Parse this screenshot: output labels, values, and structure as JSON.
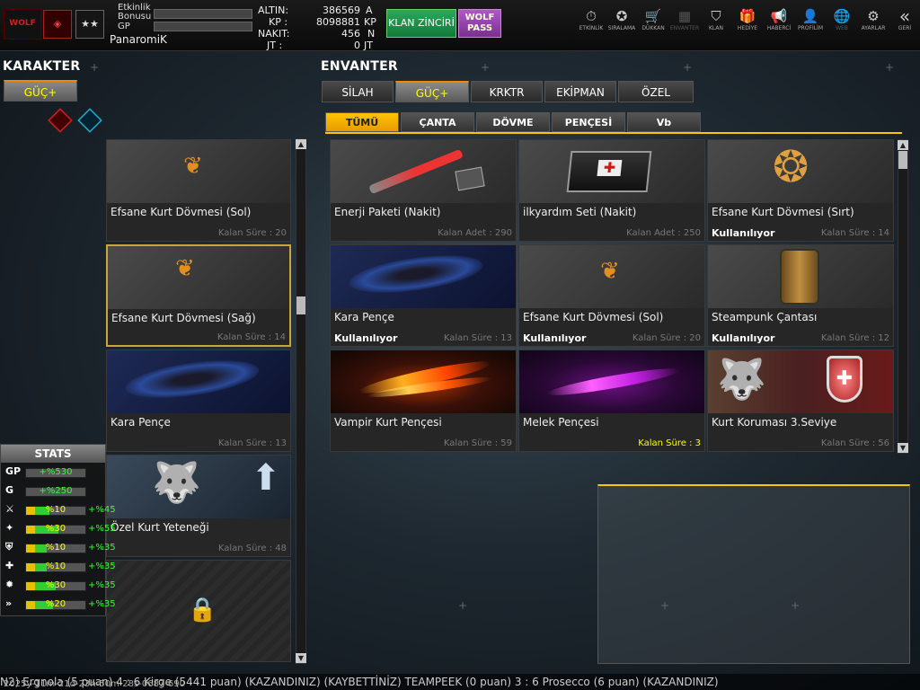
{
  "topbar": {
    "logo_text": "WOLF",
    "rank_text": "★★",
    "event_bonus_label": "Etkinlik Bonusu",
    "gp_label": "GP",
    "username": "PanaromiK",
    "currency": [
      {
        "label": "ALTIN:",
        "value": "386569",
        "unit": "A"
      },
      {
        "label": "KP :",
        "value": "8098881",
        "unit": "KP"
      },
      {
        "label": "NAKIT:",
        "value": "456",
        "unit": "N"
      },
      {
        "label": "JT :",
        "value": "0",
        "unit": "JT"
      }
    ],
    "klan_button": "KLAN ZİNCİRİ",
    "wolf_pass_button_line1": "WOLF",
    "wolf_pass_button_line2": "PASS",
    "nav": [
      {
        "icon": "⏱",
        "label": "ETKİNLİK"
      },
      {
        "icon": "✪",
        "label": "SIRALAMA"
      },
      {
        "icon": "🛒",
        "label": "DÜKKAN"
      },
      {
        "icon": "▦",
        "label": "ENVANTER"
      },
      {
        "icon": "⛉",
        "label": "KLAN"
      },
      {
        "icon": "🎁",
        "label": "HEDİYE"
      },
      {
        "icon": "📢",
        "label": "HABERCİ"
      },
      {
        "icon": "👤",
        "label": "PROFİLİM"
      },
      {
        "icon": "🌐",
        "label": "WEB"
      },
      {
        "icon": "⚙",
        "label": "AYARLAR"
      },
      {
        "icon": "«",
        "label": "GERİ"
      }
    ]
  },
  "character": {
    "title": "KARAKTER",
    "tab": "GÜÇ+",
    "cards": [
      {
        "name": "Efsane Kurt Dövmesi (Sol)",
        "remaining": "Kalan Süre : 20"
      },
      {
        "name": "Efsane Kurt Dövmesi (Sağ)",
        "remaining": "Kalan Süre : 14"
      },
      {
        "name": "Kara Pençe",
        "remaining": "Kalan Süre : 13"
      },
      {
        "name": "Özel Kurt Yeteneği",
        "remaining": "Kalan Süre : 48"
      }
    ]
  },
  "stats": {
    "title": "STATS",
    "rows": [
      {
        "icon": "GP",
        "value": "+%530",
        "extra": "",
        "yellow_fill": 0,
        "green_fill": 0
      },
      {
        "icon": "G",
        "value": "+%250",
        "extra": "",
        "yellow_fill": 0,
        "green_fill": 0
      },
      {
        "icon": "⚔",
        "value": "%10",
        "extra": "+%45",
        "yellow_fill": 0.15,
        "green_fill": 0.25
      },
      {
        "icon": "✦",
        "value": "%30",
        "extra": "+%55",
        "yellow_fill": 0.15,
        "green_fill": 0.4
      },
      {
        "icon": "⛨",
        "value": "%10",
        "extra": "+%35",
        "yellow_fill": 0.15,
        "green_fill": 0.2
      },
      {
        "icon": "✚",
        "value": "%10",
        "extra": "+%35",
        "yellow_fill": 0.15,
        "green_fill": 0.2
      },
      {
        "icon": "✹",
        "value": "%30",
        "extra": "+%35",
        "yellow_fill": 0.15,
        "green_fill": 0.35
      },
      {
        "icon": "»",
        "value": "%20",
        "extra": "+%35",
        "yellow_fill": 0.15,
        "green_fill": 0.3
      }
    ]
  },
  "inventory": {
    "title": "ENVANTER",
    "tabs": [
      "SİLAH",
      "GÜÇ+",
      "KRKTR",
      "EKİPMAN",
      "ÖZEL"
    ],
    "active_tab": "GÜÇ+",
    "subtabs": [
      "TÜMÜ",
      "ÇANTA",
      "DÖVME",
      "PENÇESİ",
      "Vb"
    ],
    "active_subtab": "TÜMÜ",
    "items": [
      {
        "name": "Enerji Paketi (Nakit)",
        "remaining": "Kalan Adet : 290",
        "in_use": ""
      },
      {
        "name": "ilkyardım Seti (Nakit)",
        "remaining": "Kalan Adet : 250",
        "in_use": ""
      },
      {
        "name": "Efsane Kurt Dövmesi (Sırt)",
        "remaining": "Kalan Süre : 14",
        "in_use": "Kullanılıyor"
      },
      {
        "name": "Kara Pençe",
        "remaining": "Kalan Süre : 13",
        "in_use": "Kullanılıyor"
      },
      {
        "name": "Efsane Kurt Dövmesi (Sol)",
        "remaining": "Kalan Süre : 20",
        "in_use": "Kullanılıyor"
      },
      {
        "name": "Steampunk Çantası",
        "remaining": "Kalan Süre : 12",
        "in_use": "Kullanılıyor"
      },
      {
        "name": "Vampir Kurt Pençesi",
        "remaining": "Kalan Süre : 59",
        "in_use": ""
      },
      {
        "name": "Melek Pençesi",
        "remaining": "Kalan Süre : 3",
        "in_use": ""
      },
      {
        "name": "Kurt Koruması 3.Seviye",
        "remaining": "Kalan Süre : 56",
        "in_use": ""
      }
    ]
  },
  "ticker": {
    "text": "N2) Ergnola (5 puan) 4 : 6 Kirge (5441 puan) (KAZANDINIZ)      (KAYBETTİNİZ) TEAMPEEK (0 puan) 3 : 6 Prosecco (6 puan) (KAZANDINIZ)",
    "timestamp": "2025y-11m-21d-23h-50m-28s-0687-690"
  },
  "colors": {
    "accent": "#ffc400",
    "selected_border": "#c9a53a",
    "stat_green": "#33ff33",
    "stat_yellow": "#ffff00"
  }
}
